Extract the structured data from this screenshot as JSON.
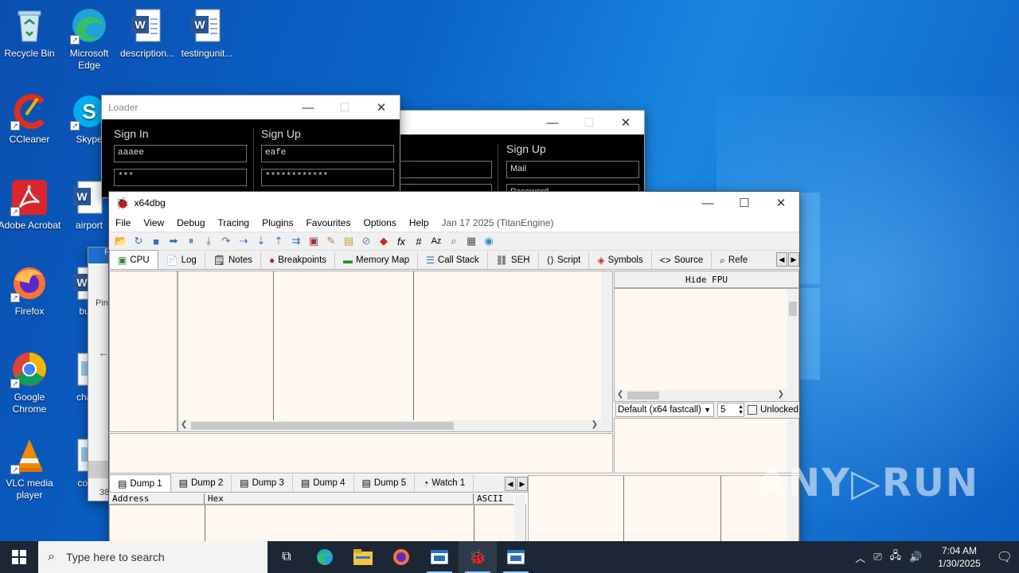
{
  "desktop": {
    "icons": [
      {
        "label": "Recycle Bin"
      },
      {
        "label": "Microsoft Edge"
      },
      {
        "label": "description..."
      },
      {
        "label": "testingunit..."
      },
      {
        "label": "CCleaner"
      },
      {
        "label": "Skype"
      },
      {
        "label": "Adobe Acrobat"
      },
      {
        "label": "airport"
      },
      {
        "label": "Firefox"
      },
      {
        "label": "build"
      },
      {
        "label": "Google Chrome"
      },
      {
        "label": "chanc"
      },
      {
        "label": "VLC media player"
      },
      {
        "label": "comp"
      }
    ],
    "watermark": "ANY▷RUN",
    "partial_left": {
      "pin": "Pin",
      "num": "38"
    }
  },
  "loader_front": {
    "title": "Loader",
    "sign_in": {
      "heading": "Sign In",
      "user": "aaaee",
      "pass": "***"
    },
    "sign_up": {
      "heading": "Sign Up",
      "user": "eafe",
      "pass": "************"
    }
  },
  "loader_back": {
    "sign_up": {
      "heading": "Sign Up",
      "mail": "Mail",
      "password": "Password"
    }
  },
  "x64dbg": {
    "title": "x64dbg",
    "menu": [
      "File",
      "View",
      "Debug",
      "Tracing",
      "Plugins",
      "Favourites",
      "Options",
      "Help"
    ],
    "build_info": "Jan 17 2025 (TitanEngine)",
    "tabs": [
      "CPU",
      "Log",
      "Notes",
      "Breakpoints",
      "Memory Map",
      "Call Stack",
      "SEH",
      "Script",
      "Symbols",
      "Source",
      "Refe"
    ],
    "hide_fpu": "Hide FPU",
    "callconv": "Default (x64 fastcall)",
    "arg_count": "5",
    "unlocked": "Unlocked",
    "dump_tabs": [
      "Dump 1",
      "Dump 2",
      "Dump 3",
      "Dump 4",
      "Dump 5",
      "Watch 1"
    ],
    "dump_headers": {
      "address": "Address",
      "hex": "Hex",
      "ascii": "ASCII"
    }
  },
  "taskbar": {
    "search_placeholder": "Type here to search",
    "time": "7:04 AM",
    "date": "1/30/2025"
  },
  "colors": {
    "desktop_blue": "#0a63c8",
    "taskbar": "#1c2634",
    "dbg_pane_bg": "#fff8f0"
  }
}
